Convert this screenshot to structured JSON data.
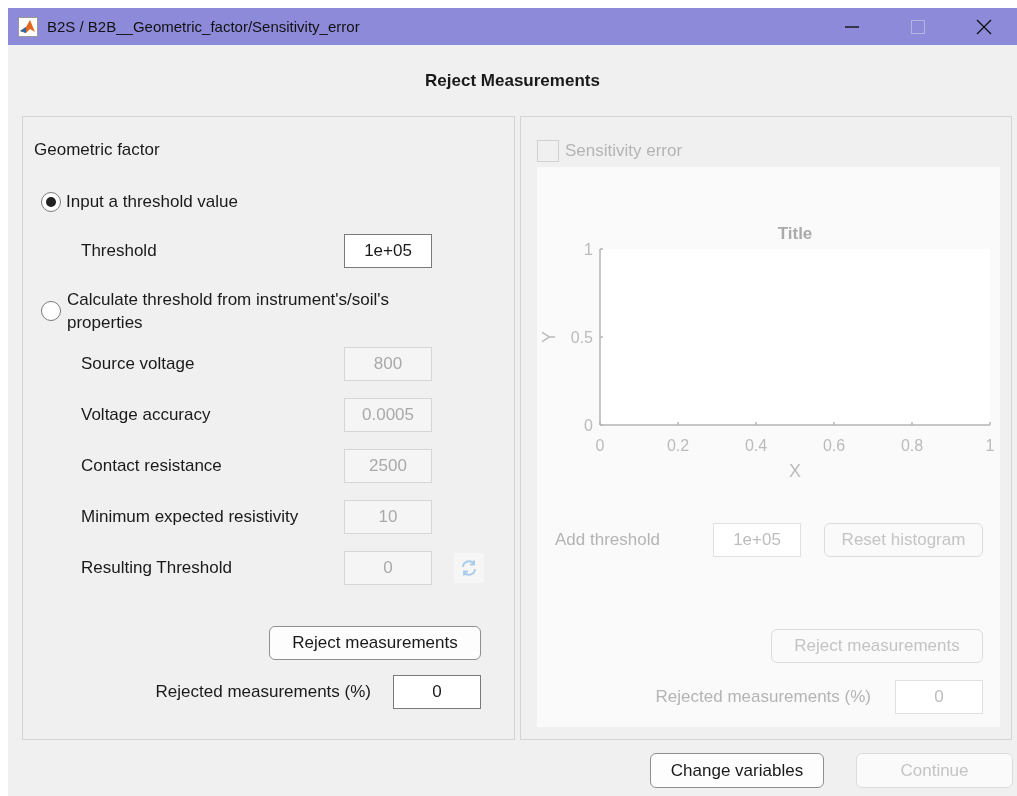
{
  "window": {
    "title": "B2S / B2B__Geometric_factor/Sensitivity_error"
  },
  "heading": "Reject Measurements",
  "geometric_panel": {
    "title": "Geometric factor",
    "options": [
      {
        "label": "Input a threshold value",
        "selected": true
      },
      {
        "label": "Calculate threshold from instrument's/soil's properties",
        "selected": false
      }
    ],
    "threshold": {
      "label": "Threshold",
      "value": "1e+05",
      "disabled": false
    },
    "properties": [
      {
        "kind": "field",
        "label": "Source voltage",
        "value": "800",
        "disabled": true
      },
      {
        "kind": "field",
        "label": "Voltage accuracy",
        "value": "0.0005",
        "disabled": true
      },
      {
        "kind": "field",
        "label": "Contact resistance",
        "value": "2500",
        "disabled": true
      },
      {
        "kind": "field",
        "label": "Minimum expected resistivity",
        "value": "10",
        "disabled": true
      },
      {
        "kind": "refresh",
        "label": "Resulting Threshold",
        "value": "0",
        "disabled": true
      }
    ],
    "reject_button": {
      "label": "Reject measurements",
      "disabled": false
    },
    "rejected": {
      "label": "Rejected measurements (%)",
      "value": "0",
      "disabled": false
    }
  },
  "sensitivity_panel": {
    "checkbox": {
      "label": "Sensitivity error",
      "checked": false,
      "disabled": true
    },
    "chart_data": {
      "type": "line",
      "title": "Title",
      "xlabel": "X",
      "ylabel": "Y",
      "xlim": [
        0,
        1
      ],
      "ylim": [
        0,
        1
      ],
      "xticks": [
        0,
        0.2,
        0.4,
        0.6,
        0.8,
        1
      ],
      "yticks": [
        0,
        0.5,
        1
      ]
    },
    "add_threshold": {
      "label": "Add threshold",
      "value": "1e+05",
      "disabled": true
    },
    "reset_button": {
      "label": "Reset histogram",
      "disabled": true
    },
    "reject_button": {
      "label": "Reject measurements",
      "disabled": true
    },
    "rejected": {
      "label": "Rejected measurements (%)",
      "value": "0",
      "disabled": true
    }
  },
  "buttons": [
    {
      "label": "Change variables",
      "disabled": false
    },
    {
      "label": "Continue",
      "disabled": true
    }
  ]
}
